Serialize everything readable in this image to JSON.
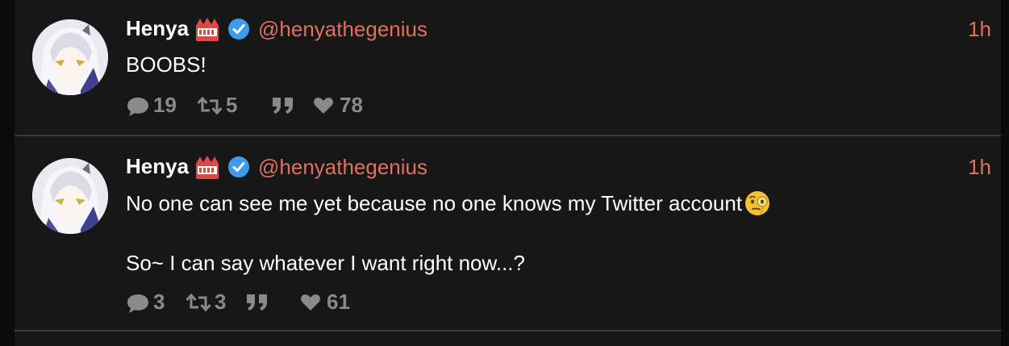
{
  "tweets": [
    {
      "name": "Henya",
      "handle": "@henyathegenius",
      "time": "1h",
      "lines": [
        "BOOBS!"
      ],
      "replies": "19",
      "retweets": "5",
      "likes": "78"
    },
    {
      "name": "Henya",
      "handle": "@henyathegenius",
      "time": "1h",
      "lines": [
        "No one can see me yet because no one knows my Twitter account",
        "So~ I can say whatever I want right now...?"
      ],
      "replies": "3",
      "retweets": "3",
      "likes": "61"
    }
  ],
  "icons": {
    "name_badge": "crown-icon",
    "verified": "verified-icon",
    "emoji": "monocle-face-icon",
    "reply": "reply-icon",
    "retweet": "retweet-icon",
    "quote": "quote-icon",
    "like": "heart-icon"
  },
  "colors": {
    "background": "#171717",
    "handle": "#e0705f",
    "verified": "#3d9bf0",
    "action_gray": "#8a8a8a"
  }
}
